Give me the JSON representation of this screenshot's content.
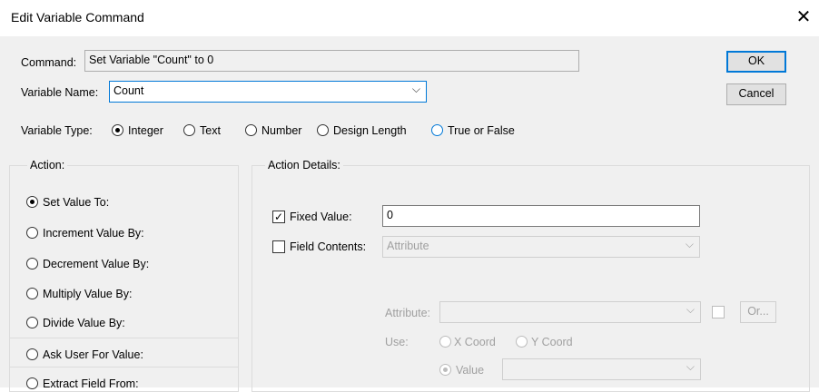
{
  "window": {
    "title": "Edit Variable Command",
    "close_glyph": "✕"
  },
  "command": {
    "label": "Command:",
    "value": "Set Variable \"Count\" to 0"
  },
  "variable_name": {
    "label": "Variable Name:",
    "value": "Count"
  },
  "buttons": {
    "ok": "OK",
    "cancel": "Cancel",
    "or": "Or..."
  },
  "variable_type": {
    "label": "Variable Type:",
    "options": [
      "Integer",
      "Text",
      "Number",
      "Design Length",
      "True or False"
    ],
    "selected": "Integer"
  },
  "action": {
    "label": "Action:",
    "options": [
      "Set Value To:",
      "Increment Value By:",
      "Decrement Value By:",
      "Multiply Value By:",
      "Divide Value By:",
      "Ask User For Value:",
      "Extract Field From:"
    ],
    "selected": "Set Value To:"
  },
  "action_details": {
    "label": "Action Details:",
    "fixed_value": {
      "label": "Fixed Value:",
      "checked": true,
      "value": "0"
    },
    "field_contents": {
      "label": "Field Contents:",
      "checked": false,
      "value": "Attribute"
    },
    "attribute": {
      "label": "Attribute:",
      "value": ""
    },
    "use": {
      "label": "Use:",
      "x_coord": "X Coord",
      "y_coord": "Y Coord",
      "value": "Value"
    }
  },
  "colors": {
    "accent": "#0078d7",
    "dialog_bg": "#f0f0f0",
    "disabled_text": "#a0a0a0"
  },
  "icons": {
    "close": "close-icon",
    "dropdown": "chevron-down-icon",
    "check": "checkmark-icon"
  }
}
